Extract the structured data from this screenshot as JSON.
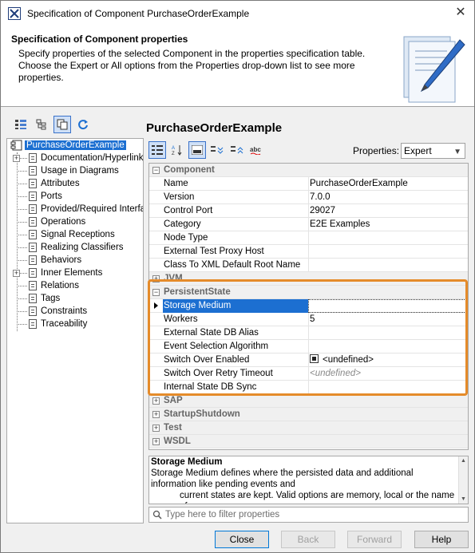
{
  "window": {
    "title": "Specification of Component PurchaseOrderExample",
    "close_glyph": "✕"
  },
  "header": {
    "title": "Specification of Component properties",
    "description": "Specify properties of the selected Component in the properties specification table. Choose the Expert or All options from the Properties drop-down list to see more properties."
  },
  "tree": {
    "root": "PurchaseOrderExample",
    "items": [
      {
        "label": "Documentation/Hyperlinks",
        "expandable": true
      },
      {
        "label": "Usage in Diagrams",
        "expandable": false
      },
      {
        "label": "Attributes",
        "expandable": false
      },
      {
        "label": "Ports",
        "expandable": false
      },
      {
        "label": "Provided/Required Interfaces",
        "expandable": false
      },
      {
        "label": "Operations",
        "expandable": false
      },
      {
        "label": "Signal Receptions",
        "expandable": false
      },
      {
        "label": "Realizing Classifiers",
        "expandable": false
      },
      {
        "label": "Behaviors",
        "expandable": false
      },
      {
        "label": "Inner Elements",
        "expandable": true
      },
      {
        "label": "Relations",
        "expandable": false
      },
      {
        "label": "Tags",
        "expandable": false
      },
      {
        "label": "Constraints",
        "expandable": false
      },
      {
        "label": "Traceability",
        "expandable": false
      }
    ]
  },
  "right": {
    "title": "PurchaseOrderExample",
    "properties_label": "Properties:",
    "properties_value": "Expert"
  },
  "grid": {
    "component": {
      "label": "Component",
      "rows": [
        {
          "key": "Name",
          "value": "PurchaseOrderExample"
        },
        {
          "key": "Version",
          "value": "7.0.0"
        },
        {
          "key": "Control Port",
          "value": "29027"
        },
        {
          "key": "Category",
          "value": "E2E Examples"
        },
        {
          "key": "Node Type",
          "value": ""
        },
        {
          "key": "External Test Proxy Host",
          "value": ""
        },
        {
          "key": "Class To XML Default Root Name",
          "value": ""
        }
      ]
    },
    "jvm": {
      "label": "JVM"
    },
    "persistent": {
      "label": "PersistentState",
      "rows": [
        {
          "key": "Storage Medium",
          "value": ""
        },
        {
          "key": "Workers",
          "value": "5"
        },
        {
          "key": "External State DB Alias",
          "value": ""
        },
        {
          "key": "Event Selection Algorithm",
          "value": ""
        },
        {
          "key": "Switch Over Enabled",
          "value": "<undefined>"
        },
        {
          "key": "Switch Over Retry Timeout",
          "value": "<undefined>"
        },
        {
          "key": "Internal State DB Sync",
          "value": ""
        }
      ]
    },
    "collapsed": [
      "SAP",
      "StartupShutdown",
      "Test",
      "WSDL"
    ]
  },
  "description": {
    "title": "Storage Medium",
    "line1": "Storage Medium defines where the persisted data and additional information like pending events and",
    "line2": "current states are kept. Valid options are memory, local or the name of"
  },
  "filter": {
    "placeholder": "Type here to filter properties"
  },
  "buttons": {
    "close": "Close",
    "back": "Back",
    "forward": "Forward",
    "help": "Help"
  },
  "colors": {
    "selection": "#1c6fd1",
    "highlight": "#e58b2a"
  }
}
